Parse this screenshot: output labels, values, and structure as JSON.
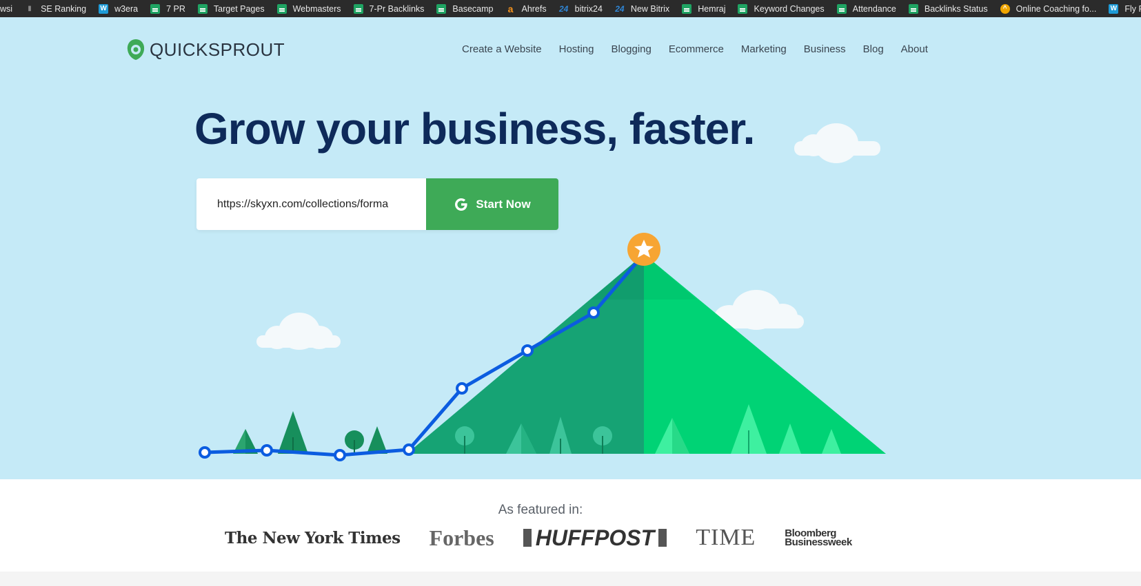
{
  "bookmarks": [
    {
      "label": "wsi",
      "icon": "none"
    },
    {
      "label": "SE Ranking",
      "icon": "bars-icon"
    },
    {
      "label": "w3era",
      "icon": "w-icon"
    },
    {
      "label": "7 PR",
      "icon": "sheet-icon"
    },
    {
      "label": "Target Pages",
      "icon": "sheet-icon"
    },
    {
      "label": "Webmasters",
      "icon": "sheet-icon"
    },
    {
      "label": "7-Pr Backlinks",
      "icon": "sheet-icon"
    },
    {
      "label": "Basecamp",
      "icon": "sheet-icon"
    },
    {
      "label": "Ahrefs",
      "icon": "ahrefs-icon"
    },
    {
      "label": "bitrix24",
      "icon": "bitrix-icon"
    },
    {
      "label": "New Bitrix",
      "icon": "bitrix-icon"
    },
    {
      "label": "Hemraj",
      "icon": "sheet-icon"
    },
    {
      "label": "Keyword Changes",
      "icon": "sheet-icon"
    },
    {
      "label": "Attendance",
      "icon": "sheet-icon"
    },
    {
      "label": "Backlinks Status",
      "icon": "sheet-icon"
    },
    {
      "label": "Online Coaching fo...",
      "icon": "coaching-icon"
    },
    {
      "label": "Fly Fishing in Chi",
      "icon": "w-icon"
    }
  ],
  "header": {
    "logo_text": "QUICKSPROUT",
    "nav": [
      "Create a Website",
      "Hosting",
      "Blogging",
      "Ecommerce",
      "Marketing",
      "Business",
      "Blog",
      "About"
    ]
  },
  "hero": {
    "headline": "Grow your business, faster.",
    "url_value": "https://skyxn.com/collections/forma",
    "start_label": "Start Now"
  },
  "featured": {
    "label": "As featured in:",
    "publications": [
      "The New York Times",
      "Forbes",
      "HUFFPOST",
      "TIME",
      "Bloomberg Businessweek"
    ]
  },
  "colors": {
    "hero_bg": "#c5eaf7",
    "headline": "#0e2a5a",
    "button": "#3eaa57",
    "line": "#0b5ce0",
    "star": "#f7a533",
    "mountain_dark": "#16a374",
    "mountain_light": "#00d375"
  }
}
